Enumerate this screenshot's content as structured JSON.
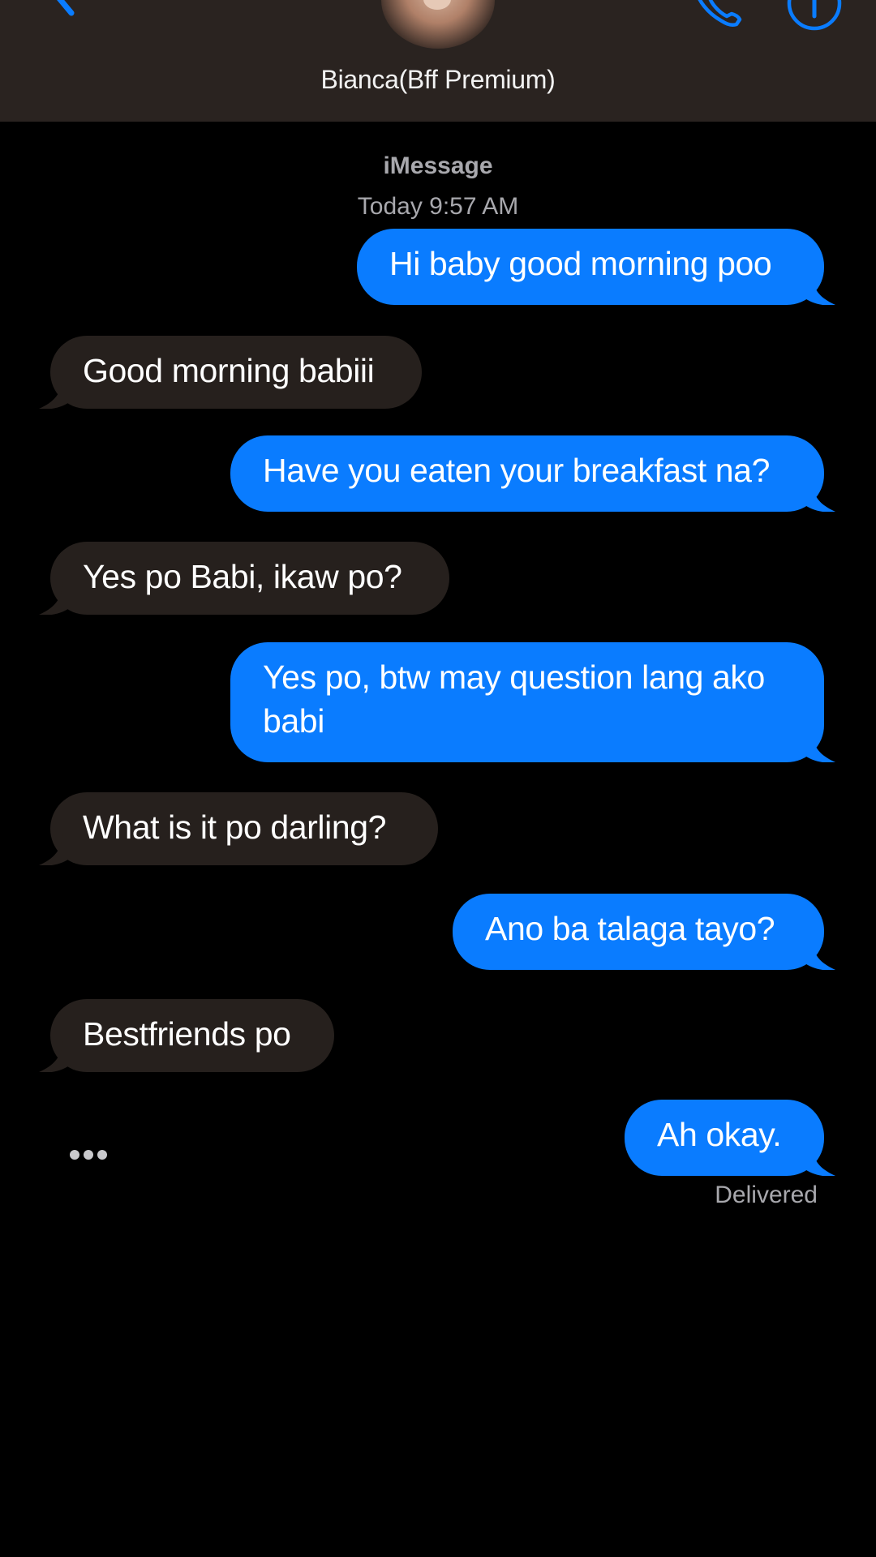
{
  "header": {
    "contact_name": "Bianca(Bff Premium)",
    "icons": [
      "back-chevron-icon",
      "phone-icon",
      "info-icon"
    ],
    "accent_color": "#0a7cff"
  },
  "thread": {
    "service_label": "iMessage",
    "timestamp": "Today 9:57 AM",
    "messages": [
      {
        "direction": "sent",
        "text": "Hi baby good morning poo"
      },
      {
        "direction": "received",
        "text": "Good morning babiii"
      },
      {
        "direction": "sent",
        "text": "Have you eaten your breakfast na?"
      },
      {
        "direction": "received",
        "text": "Yes po Babi, ikaw po?"
      },
      {
        "direction": "sent",
        "text": "Yes po, btw may question lang ako babi"
      },
      {
        "direction": "received",
        "text": "What is it po darling?"
      },
      {
        "direction": "sent",
        "text": "Ano ba talaga tayo?"
      },
      {
        "direction": "received",
        "text": "Bestfriends po"
      },
      {
        "direction": "sent",
        "text": "Ah okay."
      }
    ],
    "delivery_status": "Delivered",
    "sent_bubble_color": "#0a7cff",
    "received_bubble_color": "#26201d"
  }
}
